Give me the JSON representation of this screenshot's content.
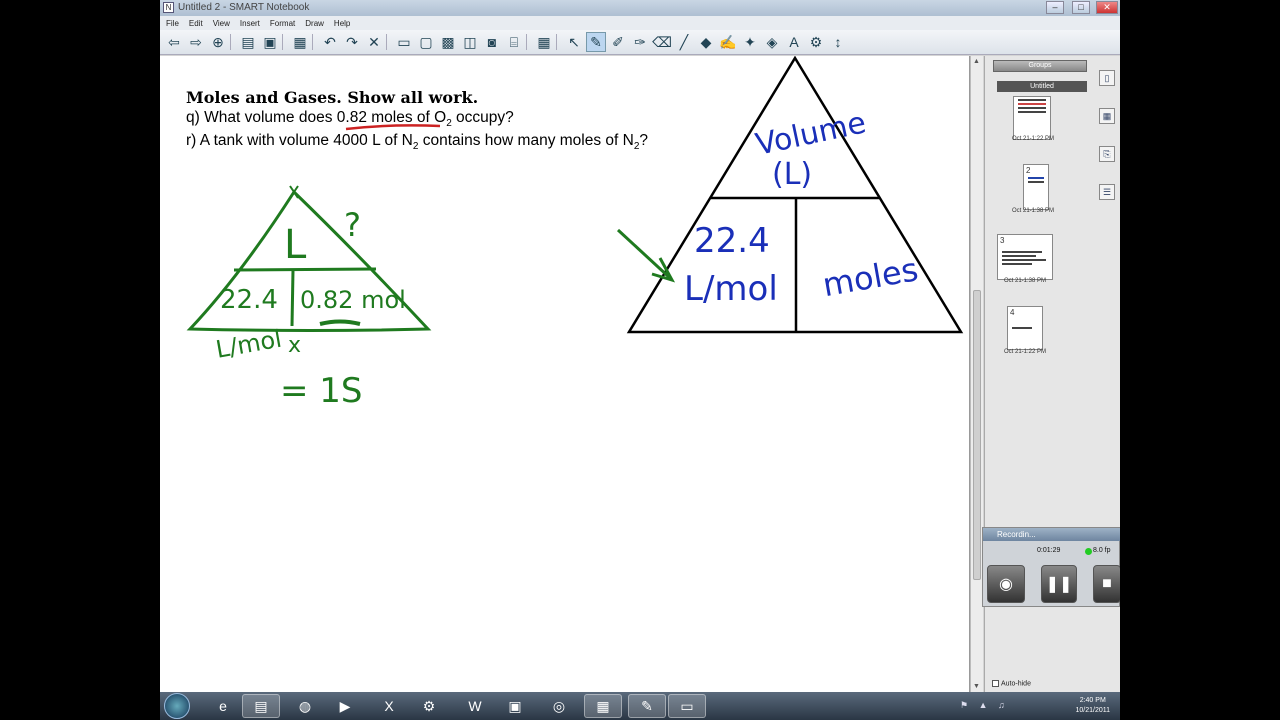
{
  "window": {
    "title": "Untitled 2 - SMART Notebook",
    "buttons": [
      "–",
      "□",
      "✕"
    ]
  },
  "menu": [
    "File",
    "Edit",
    "View",
    "Insert",
    "Format",
    "Draw",
    "Help"
  ],
  "toolbar": {
    "icons": [
      "back-icon",
      "forward-icon",
      "add-page-icon",
      "open-icon",
      "save-icon",
      "paste-icon",
      "undo-icon",
      "redo-icon",
      "delete-icon",
      "screen-shade-icon",
      "full-screen-icon",
      "transparent-icon",
      "dual-page-icon",
      "capture-icon",
      "document-camera-icon",
      "table-icon",
      "select-icon",
      "pen-icon",
      "creative-pen-icon",
      "magic-pen-icon",
      "eraser-icon",
      "line-icon",
      "shape-icon",
      "recognition-pen-icon",
      "fill-icon",
      "text-icon",
      "properties-icon",
      "more-icon"
    ]
  },
  "page": {
    "heading": "Moles and Gases. Show all work.",
    "question_q": {
      "prefix": "q) What volume does ",
      "underlined": "0.82 moles of O",
      "sub": "2",
      "suffix": " occupy?"
    },
    "question_r": {
      "prefix": "r) A tank with volume 4000 L of N",
      "sub1": "2",
      "middle": " contains how many moles of N",
      "sub2": "2",
      "suffix": "?"
    },
    "ink_left": {
      "top": "L",
      "question": "?",
      "bottom_left": "22.4",
      "bottom_left2": "L/mol",
      "bottom_right": "0.82 mol",
      "times": "x",
      "result": "= 1S"
    },
    "ink_right": {
      "top1": "Volume",
      "top2": "(L)",
      "bottom_left1": "22.4",
      "bottom_left2": "L/mol",
      "bottom_right": "moles"
    },
    "colors": {
      "green_ink": "#1f7a1f",
      "blue_ink": "#1a2fb8",
      "red_ink": "#cc2222"
    }
  },
  "sidebar": {
    "groups_label": "Groups",
    "title_label": "Untitled",
    "thumbnails": [
      {
        "num": "1",
        "date": "Oct 21-1:22 PM"
      },
      {
        "num": "2",
        "date": "Oct 21-1:38 PM"
      },
      {
        "num": "3",
        "date": "Oct 21-1:38 PM"
      },
      {
        "num": "4",
        "date": "Oct 21-1:22 PM"
      }
    ]
  },
  "recorder": {
    "title": "Recordin...",
    "time": "0:01:29",
    "fps": "8.0 fp"
  },
  "autohide": "Auto-hide",
  "clock": {
    "time": "2:40 PM",
    "date": "10/21/2011"
  }
}
